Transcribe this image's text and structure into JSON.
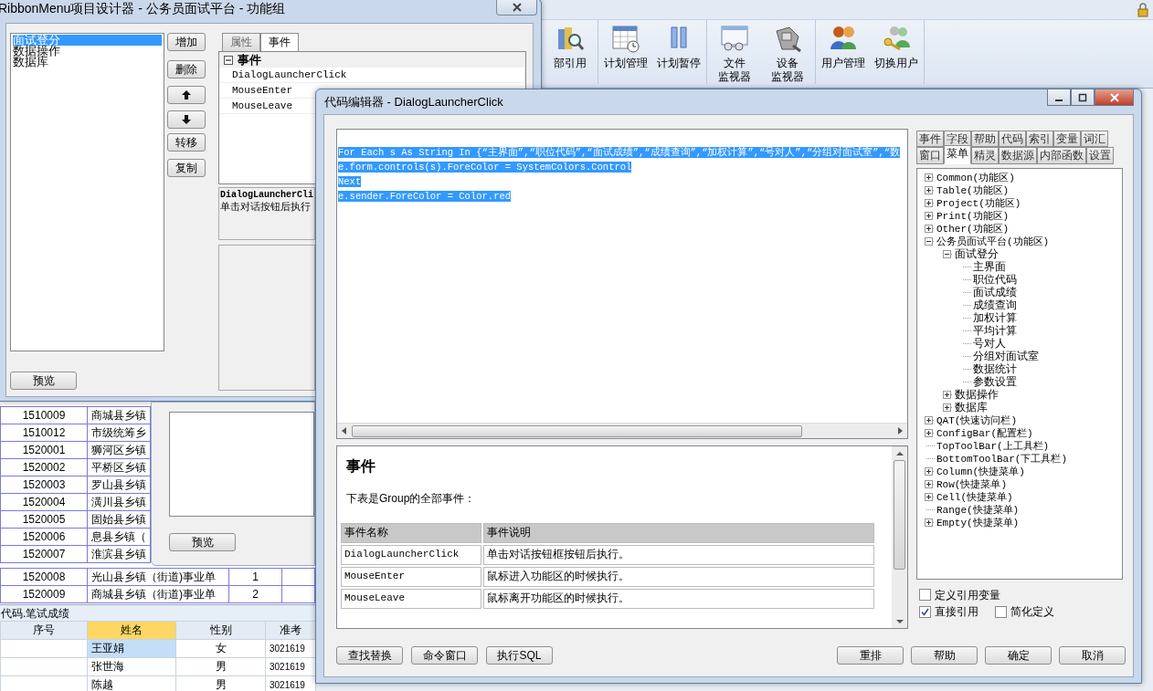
{
  "app": {
    "ribbon": [
      {
        "items": [
          {
            "lines": [
              "部引用"
            ]
          }
        ]
      },
      {
        "items": [
          {
            "lines": [
              "计划管理"
            ]
          },
          {
            "lines": [
              "计划暂停"
            ]
          }
        ]
      },
      {
        "items": [
          {
            "lines": [
              "文件",
              "监视器"
            ]
          },
          {
            "lines": [
              "设备",
              "监视器"
            ]
          }
        ]
      },
      {
        "items": [
          {
            "lines": [
              "用户管理"
            ]
          },
          {
            "lines": [
              "切换用户"
            ]
          }
        ]
      }
    ],
    "grid": {
      "upper_rows": [
        {
          "code": "1510009",
          "name": "商城县乡镇"
        },
        {
          "code": "1510012",
          "name": "市级统筹乡"
        },
        {
          "code": "1520001",
          "name": "狮河区乡镇"
        },
        {
          "code": "1520002",
          "name": "平桥区乡镇"
        },
        {
          "code": "1520003",
          "name": "罗山县乡镇"
        },
        {
          "code": "1520004",
          "name": "潢川县乡镇"
        },
        {
          "code": "1520005",
          "name": "固始县乡镇"
        },
        {
          "code": "1520006",
          "name": "息县乡镇（"
        },
        {
          "code": "1520007",
          "name": "淮滨县乡镇"
        }
      ],
      "lower_rows": [
        {
          "code": "1520008",
          "name": "光山县乡镇（街道)事业单",
          "count": "1"
        },
        {
          "code": "1520009",
          "name": "商城县乡镇（街道)事业单",
          "count": "2"
        }
      ]
    },
    "bottom_table": {
      "title": "代码.笔试成绩",
      "columns": [
        {
          "label": "序号",
          "selected": false
        },
        {
          "label": "姓名",
          "selected": true
        },
        {
          "label": "性别",
          "selected": false
        },
        {
          "label": "准考",
          "selected": false
        }
      ],
      "rows": [
        {
          "name": "王亚娟",
          "gender": "女",
          "exam_id": "3021619",
          "selected": true
        },
        {
          "name": "张世海",
          "gender": "男",
          "exam_id": "3021619",
          "selected": false
        },
        {
          "name": "陈越",
          "gender": "男",
          "exam_id": "3021619",
          "selected": false
        }
      ]
    }
  },
  "designer": {
    "title": "RibbonMenu项目设计器 - 公务员面试平台 - 功能组",
    "list": [
      {
        "label": "面试登分",
        "selected": true
      },
      {
        "label": "数据操作",
        "selected": false
      },
      {
        "label": "数据库",
        "selected": false
      }
    ],
    "buttons": [
      {
        "kind": "text",
        "label": "增加"
      },
      {
        "kind": "text",
        "label": "删除"
      },
      {
        "kind": "up"
      },
      {
        "kind": "down"
      },
      {
        "kind": "text",
        "label": "转移"
      },
      {
        "kind": "text",
        "label": "复制"
      }
    ],
    "tabs": [
      {
        "label": "属性",
        "selected": false
      },
      {
        "label": "事件",
        "selected": true
      }
    ],
    "property_grid": {
      "category": "事件",
      "expanded": true,
      "rows": [
        "DialogLauncherClick",
        "MouseEnter",
        "MouseLeave"
      ]
    },
    "description": {
      "title": "DialogLauncherCli",
      "text": "单击对话按钮后执行"
    },
    "preview_button": "预览"
  },
  "panel": {
    "preview_button": "预览"
  },
  "editor": {
    "title": "代码编辑器 - DialogLauncherClick",
    "code": {
      "selected": true,
      "lines": [
        "For Each s As String In {“主界面”,“职位代码”,“面试成绩”,“成绩查询”,“加权计算”,“号对人”,“分组对面试室”,“数",
        "e.form.controls(s).ForeColor = SystemColors.Control",
        "Next",
        "e.sender.ForeColor = Color.red"
      ]
    },
    "help": {
      "heading": "事件",
      "intro": "下表是Group的全部事件：",
      "columns": [
        "事件名称",
        "事件说明"
      ],
      "rows": [
        [
          "DialogLauncherClick",
          "单击对话按钮框按钮后执行。"
        ],
        [
          "MouseEnter",
          "鼠标进入功能区的时候执行。"
        ],
        [
          "MouseLeave",
          "鼠标离开功能区的时候执行。"
        ]
      ]
    },
    "side_tabs": [
      [
        {
          "label": "事件",
          "selected": false
        },
        {
          "label": "字段",
          "selected": false
        },
        {
          "label": "帮助",
          "selected": false
        },
        {
          "label": "代码",
          "selected": false
        },
        {
          "label": "索引",
          "selected": false
        },
        {
          "label": "变量",
          "selected": false
        },
        {
          "label": "词汇",
          "selected": false
        }
      ],
      [
        {
          "label": "窗口",
          "selected": false
        },
        {
          "label": "菜单",
          "selected": true
        },
        {
          "label": "精灵",
          "selected": false
        },
        {
          "label": "数据源",
          "selected": false
        },
        {
          "label": "内部函数",
          "selected": false
        },
        {
          "label": "设置",
          "selected": false
        }
      ]
    ],
    "tree": [
      {
        "label": "Common(功能区)",
        "expanded": false
      },
      {
        "label": "Table(功能区)",
        "expanded": false
      },
      {
        "label": "Project(功能区)",
        "expanded": false
      },
      {
        "label": "Print(功能区)",
        "expanded": false
      },
      {
        "label": "Other(功能区)",
        "expanded": false
      },
      {
        "label": "公务员面试平台(功能区)",
        "expanded": true,
        "children": [
          {
            "label": "面试登分",
            "expanded": true,
            "children": [
              {
                "label": "主界面"
              },
              {
                "label": "职位代码"
              },
              {
                "label": "面试成绩"
              },
              {
                "label": "成绩查询"
              },
              {
                "label": "加权计算"
              },
              {
                "label": "平均计算"
              },
              {
                "label": "号对人"
              },
              {
                "label": "分组对面试室"
              },
              {
                "label": "数据统计"
              },
              {
                "label": "参数设置"
              }
            ]
          },
          {
            "label": "数据操作",
            "expanded": false
          },
          {
            "label": "数据库",
            "expanded": false
          }
        ]
      },
      {
        "label": "QAT(快速访问栏)",
        "expanded": false
      },
      {
        "label": "ConfigBar(配置栏)",
        "expanded": false
      },
      {
        "label": "TopToolBar(上工具栏)"
      },
      {
        "label": "BottomToolBar(下工具栏)"
      },
      {
        "label": "Column(快捷菜单)",
        "expanded": false
      },
      {
        "label": "Row(快捷菜单)",
        "expanded": false
      },
      {
        "label": "Cell(快捷菜单)",
        "expanded": false
      },
      {
        "label": "Range(快捷菜单)"
      },
      {
        "label": "Empty(快捷菜单)",
        "expanded": false
      }
    ],
    "options": [
      {
        "label": "定义引用变量",
        "checked": false
      },
      {
        "label": "直接引用",
        "checked": true
      },
      {
        "label": "简化定义",
        "checked": false
      }
    ],
    "left_buttons": [
      "查找替换",
      "命令窗口",
      "执行SQL"
    ],
    "right_buttons": [
      "重排",
      "帮助",
      "确定",
      "取消"
    ]
  }
}
